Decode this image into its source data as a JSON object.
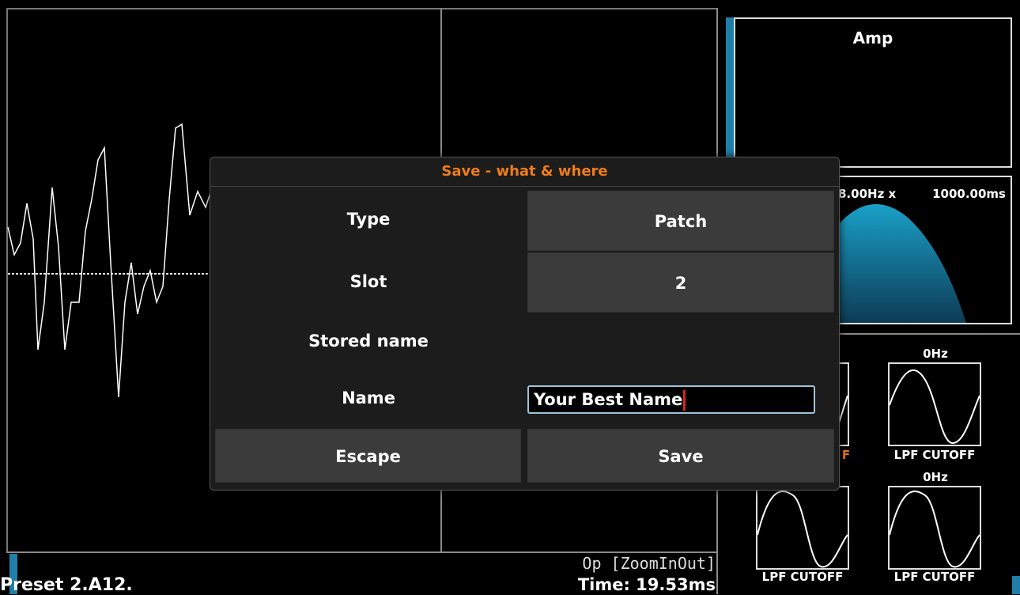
{
  "status": {
    "preset": "Preset 2.A12.",
    "op_mode": "Op [ZoomInOut]",
    "time": "Time: 19.53ms"
  },
  "right_panel": {
    "amp_title": "Amp",
    "env_left": "8.00Hz x",
    "env_right": "1000.00ms",
    "mod_top_hz": "0Hz",
    "mod_mid_hz": "0Hz",
    "mod_labels": [
      "LPF CUTOFF",
      "LPF CUTOFF",
      "LPF CUTOFF"
    ],
    "mod_partial_label": "F"
  },
  "dialog": {
    "title": "Save - what & where",
    "type_label": "Type",
    "type_value": "Patch",
    "slot_label": "Slot",
    "slot_value": "2",
    "stored_name_label": "Stored name",
    "name_label": "Name",
    "name_value": "Your Best Name",
    "escape_label": "Escape",
    "save_label": "Save"
  },
  "colors": {
    "accent": "#f07c1a",
    "envelope": "#1aa0c8",
    "indicator": "#1e7fa8"
  }
}
